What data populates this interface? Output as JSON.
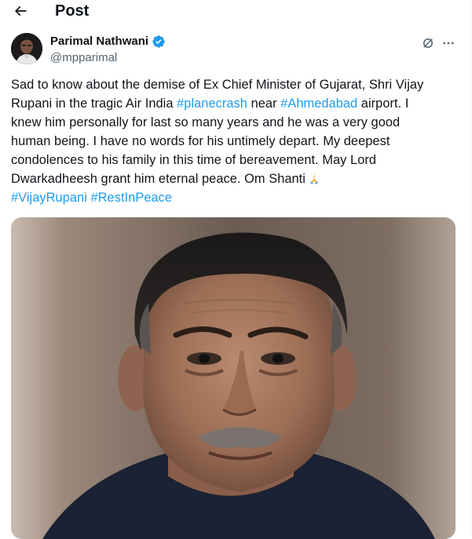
{
  "header": {
    "title": "Post",
    "back_icon": "arrow-left-icon"
  },
  "author": {
    "name": "Parimal Nathwani",
    "handle": "@mpparimal",
    "verified_color": "#1d9bf0",
    "actions": [
      "grok-icon",
      "more-icon"
    ]
  },
  "post": {
    "text_lines": [
      "Sad to know about the demise of Ex Chief Minister of Gujarat, Shri Vijay",
      "Rupani in the tragic Air India ",
      " near ",
      " airport. I",
      "knew him personally for last so many years and he was a very good",
      "human being. I have no words for his untimely depart. My deepest",
      "condolences to his family in this time of bereavement. May Lord",
      "Dwarkadheesh grant him eternal peace. Om Shanti"
    ],
    "hashtags": {
      "planecrash": "#planecrash",
      "ahmedabad": "#Ahmedabad",
      "vijayrupani": "#VijayRupani",
      "restinpeace": "#RestInPeace"
    },
    "emoji": "folded-hands-icon",
    "link_color": "#1d9bf0"
  },
  "media": {
    "image": "portrait-photo"
  }
}
